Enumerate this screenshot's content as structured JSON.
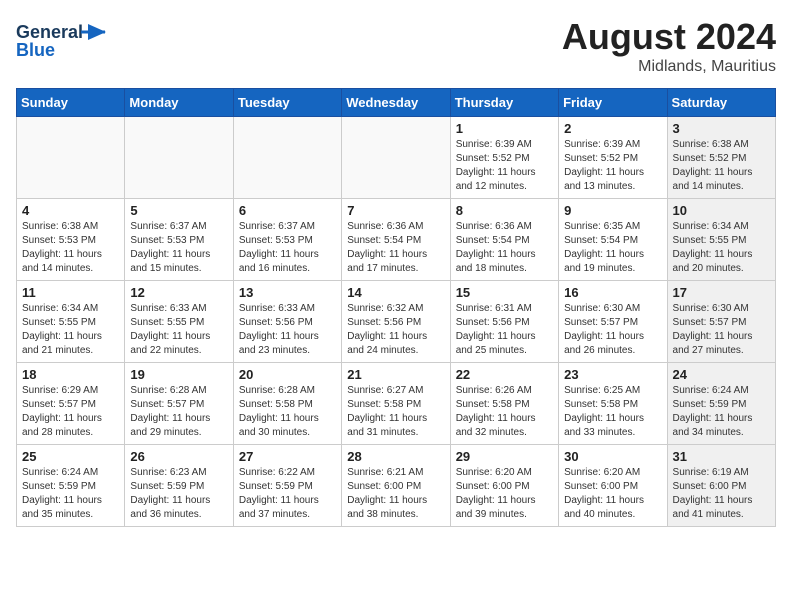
{
  "header": {
    "logo_line1": "General",
    "logo_line2": "Blue",
    "month": "August 2024",
    "location": "Midlands, Mauritius"
  },
  "days_of_week": [
    "Sunday",
    "Monday",
    "Tuesday",
    "Wednesday",
    "Thursday",
    "Friday",
    "Saturday"
  ],
  "weeks": [
    [
      {
        "day": "",
        "info": "",
        "empty": true
      },
      {
        "day": "",
        "info": "",
        "empty": true
      },
      {
        "day": "",
        "info": "",
        "empty": true
      },
      {
        "day": "",
        "info": "",
        "empty": true
      },
      {
        "day": "1",
        "info": "Sunrise: 6:39 AM\nSunset: 5:52 PM\nDaylight: 11 hours\nand 12 minutes."
      },
      {
        "day": "2",
        "info": "Sunrise: 6:39 AM\nSunset: 5:52 PM\nDaylight: 11 hours\nand 13 minutes."
      },
      {
        "day": "3",
        "info": "Sunrise: 6:38 AM\nSunset: 5:52 PM\nDaylight: 11 hours\nand 14 minutes.",
        "shaded": true
      }
    ],
    [
      {
        "day": "4",
        "info": "Sunrise: 6:38 AM\nSunset: 5:53 PM\nDaylight: 11 hours\nand 14 minutes."
      },
      {
        "day": "5",
        "info": "Sunrise: 6:37 AM\nSunset: 5:53 PM\nDaylight: 11 hours\nand 15 minutes."
      },
      {
        "day": "6",
        "info": "Sunrise: 6:37 AM\nSunset: 5:53 PM\nDaylight: 11 hours\nand 16 minutes."
      },
      {
        "day": "7",
        "info": "Sunrise: 6:36 AM\nSunset: 5:54 PM\nDaylight: 11 hours\nand 17 minutes."
      },
      {
        "day": "8",
        "info": "Sunrise: 6:36 AM\nSunset: 5:54 PM\nDaylight: 11 hours\nand 18 minutes."
      },
      {
        "day": "9",
        "info": "Sunrise: 6:35 AM\nSunset: 5:54 PM\nDaylight: 11 hours\nand 19 minutes."
      },
      {
        "day": "10",
        "info": "Sunrise: 6:34 AM\nSunset: 5:55 PM\nDaylight: 11 hours\nand 20 minutes.",
        "shaded": true
      }
    ],
    [
      {
        "day": "11",
        "info": "Sunrise: 6:34 AM\nSunset: 5:55 PM\nDaylight: 11 hours\nand 21 minutes."
      },
      {
        "day": "12",
        "info": "Sunrise: 6:33 AM\nSunset: 5:55 PM\nDaylight: 11 hours\nand 22 minutes."
      },
      {
        "day": "13",
        "info": "Sunrise: 6:33 AM\nSunset: 5:56 PM\nDaylight: 11 hours\nand 23 minutes."
      },
      {
        "day": "14",
        "info": "Sunrise: 6:32 AM\nSunset: 5:56 PM\nDaylight: 11 hours\nand 24 minutes."
      },
      {
        "day": "15",
        "info": "Sunrise: 6:31 AM\nSunset: 5:56 PM\nDaylight: 11 hours\nand 25 minutes."
      },
      {
        "day": "16",
        "info": "Sunrise: 6:30 AM\nSunset: 5:57 PM\nDaylight: 11 hours\nand 26 minutes."
      },
      {
        "day": "17",
        "info": "Sunrise: 6:30 AM\nSunset: 5:57 PM\nDaylight: 11 hours\nand 27 minutes.",
        "shaded": true
      }
    ],
    [
      {
        "day": "18",
        "info": "Sunrise: 6:29 AM\nSunset: 5:57 PM\nDaylight: 11 hours\nand 28 minutes."
      },
      {
        "day": "19",
        "info": "Sunrise: 6:28 AM\nSunset: 5:57 PM\nDaylight: 11 hours\nand 29 minutes."
      },
      {
        "day": "20",
        "info": "Sunrise: 6:28 AM\nSunset: 5:58 PM\nDaylight: 11 hours\nand 30 minutes."
      },
      {
        "day": "21",
        "info": "Sunrise: 6:27 AM\nSunset: 5:58 PM\nDaylight: 11 hours\nand 31 minutes."
      },
      {
        "day": "22",
        "info": "Sunrise: 6:26 AM\nSunset: 5:58 PM\nDaylight: 11 hours\nand 32 minutes."
      },
      {
        "day": "23",
        "info": "Sunrise: 6:25 AM\nSunset: 5:58 PM\nDaylight: 11 hours\nand 33 minutes."
      },
      {
        "day": "24",
        "info": "Sunrise: 6:24 AM\nSunset: 5:59 PM\nDaylight: 11 hours\nand 34 minutes.",
        "shaded": true
      }
    ],
    [
      {
        "day": "25",
        "info": "Sunrise: 6:24 AM\nSunset: 5:59 PM\nDaylight: 11 hours\nand 35 minutes."
      },
      {
        "day": "26",
        "info": "Sunrise: 6:23 AM\nSunset: 5:59 PM\nDaylight: 11 hours\nand 36 minutes."
      },
      {
        "day": "27",
        "info": "Sunrise: 6:22 AM\nSunset: 5:59 PM\nDaylight: 11 hours\nand 37 minutes."
      },
      {
        "day": "28",
        "info": "Sunrise: 6:21 AM\nSunset: 6:00 PM\nDaylight: 11 hours\nand 38 minutes."
      },
      {
        "day": "29",
        "info": "Sunrise: 6:20 AM\nSunset: 6:00 PM\nDaylight: 11 hours\nand 39 minutes."
      },
      {
        "day": "30",
        "info": "Sunrise: 6:20 AM\nSunset: 6:00 PM\nDaylight: 11 hours\nand 40 minutes."
      },
      {
        "day": "31",
        "info": "Sunrise: 6:19 AM\nSunset: 6:00 PM\nDaylight: 11 hours\nand 41 minutes.",
        "shaded": true
      }
    ]
  ]
}
